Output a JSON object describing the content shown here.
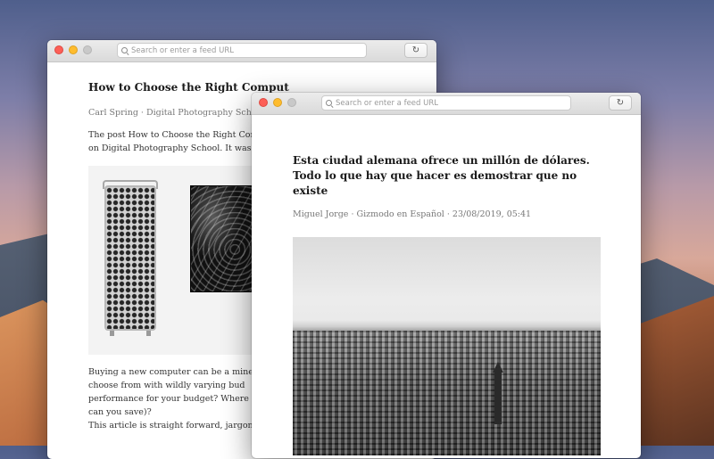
{
  "windows": {
    "back": {
      "search_placeholder": "Search or enter a feed URL",
      "reload_icon": "reload-icon",
      "title": "How to Choose the Right Comput",
      "byline": "Carl Spring · Digital Photography School ·",
      "intro_line1": "The post How to Choose the Right Comp",
      "intro_line2": "on Digital Photography School. It was aut",
      "body_lines": [
        "Buying a new computer can be a mine",
        "choose from with wildly varying bud",
        "performance for your budget? Where sho",
        "can you save)?",
        "This article is straight forward, jargon-f"
      ]
    },
    "front": {
      "search_placeholder": "Search or enter a feed URL",
      "reload_icon": "reload-icon",
      "title": "Esta ciudad alemana ofrece un millón de dólares. Todo lo que hay que hacer es demostrar que no existe",
      "byline": "Miguel Jorge · Gizmodo en Español · 23/08/2019, 05:41"
    }
  },
  "icons": {
    "search": "search-icon",
    "reload": "reload-icon"
  },
  "colors": {
    "close": "#fd5f57",
    "minimize": "#febc2e",
    "disabled": "#c9c9c9"
  }
}
